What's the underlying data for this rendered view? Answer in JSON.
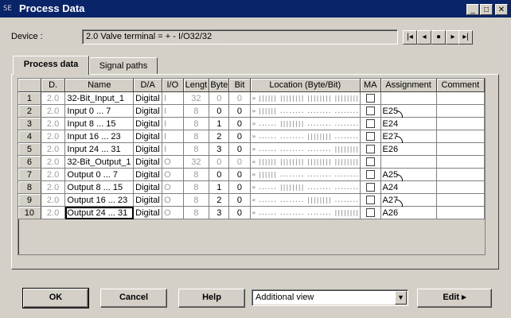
{
  "window": {
    "title": "Process Data",
    "icon_text": "SE"
  },
  "device": {
    "label": "Device :",
    "value": "2.0  Valve terminal  =  +  -   I/O32/32"
  },
  "tabs": [
    {
      "label": "Process data",
      "active": true
    },
    {
      "label": "Signal paths",
      "active": false
    }
  ],
  "table": {
    "columns": [
      "D.",
      "Name",
      "D/A",
      "I/O",
      "Lengt",
      "Byte",
      "Bit",
      "Location (Byte/Bit)",
      "MA",
      "Assignment",
      "Comment"
    ],
    "rows": [
      {
        "n": "1",
        "d": "2.0",
        "name": "32-Bit_Input_1",
        "da": "Digital",
        "io": "I",
        "len": "32",
        "byte": "0",
        "bit": "0",
        "loc": "» |||||| |||||||| |||||||| ||||||||",
        "ma": false,
        "asg": "",
        "comment": "",
        "dim": true
      },
      {
        "n": "2",
        "d": "2.0",
        "name": "Input 0 ... 7",
        "da": "Digital",
        "io": "I",
        "len": "8",
        "byte": "0",
        "bit": "0",
        "loc": "» |||||| ........ ........ ........",
        "ma": false,
        "asg": "E25",
        "comment": "",
        "dim": false
      },
      {
        "n": "3",
        "d": "2.0",
        "name": "Input 8 ... 15",
        "da": "Digital",
        "io": "I",
        "len": "8",
        "byte": "1",
        "bit": "0",
        "loc": "» ...... |||||||| ........ ........",
        "ma": false,
        "asg": "E24",
        "comment": "",
        "dim": false
      },
      {
        "n": "4",
        "d": "2.0",
        "name": "Input 16 ... 23",
        "da": "Digital",
        "io": "I",
        "len": "8",
        "byte": "2",
        "bit": "0",
        "loc": "» ...... ........ |||||||| ........",
        "ma": false,
        "asg": "E27",
        "comment": "",
        "dim": false
      },
      {
        "n": "5",
        "d": "2.0",
        "name": "Input 24 ... 31",
        "da": "Digital",
        "io": "I",
        "len": "8",
        "byte": "3",
        "bit": "0",
        "loc": "» ...... ........ ........ ||||||||",
        "ma": false,
        "asg": "E26",
        "comment": "",
        "dim": false
      },
      {
        "n": "6",
        "d": "2.0",
        "name": "32-Bit_Output_1",
        "da": "Digital",
        "io": "O",
        "len": "32",
        "byte": "0",
        "bit": "0",
        "loc": "« |||||| |||||||| |||||||| ||||||||",
        "ma": false,
        "asg": "",
        "comment": "",
        "dim": true
      },
      {
        "n": "7",
        "d": "2.0",
        "name": "Output 0 ... 7",
        "da": "Digital",
        "io": "O",
        "len": "8",
        "byte": "0",
        "bit": "0",
        "loc": "« |||||| ........ ........ ........",
        "ma": false,
        "asg": "A25",
        "comment": "",
        "dim": false
      },
      {
        "n": "8",
        "d": "2.0",
        "name": "Output 8 ... 15",
        "da": "Digital",
        "io": "O",
        "len": "8",
        "byte": "1",
        "bit": "0",
        "loc": "« ...... |||||||| ........ ........",
        "ma": false,
        "asg": "A24",
        "comment": "",
        "dim": false
      },
      {
        "n": "9",
        "d": "2.0",
        "name": "Output 16 ... 23",
        "da": "Digital",
        "io": "O",
        "len": "8",
        "byte": "2",
        "bit": "0",
        "loc": "« ...... ........ |||||||| ........",
        "ma": false,
        "asg": "A27",
        "comment": "",
        "dim": false
      },
      {
        "n": "10",
        "d": "2.0",
        "name": "Output 24 ... 31",
        "da": "Digital",
        "io": "O",
        "len": "8",
        "byte": "3",
        "bit": "0",
        "loc": "« ...... ........ ........ ||||||||",
        "ma": false,
        "asg": "A26",
        "comment": "",
        "dim": false
      }
    ]
  },
  "buttons": {
    "ok": "OK",
    "cancel": "Cancel",
    "help": "Help",
    "edit": "Edit ▸"
  },
  "additional_view": {
    "value": "Additional view"
  },
  "icons": {
    "minimize": "minimize-icon",
    "maximize": "maximize-icon",
    "close": "close-icon",
    "nav_first": "first-icon",
    "nav_prev": "prev-icon",
    "nav_current": "current-icon",
    "nav_next": "next-icon",
    "nav_last": "last-icon",
    "dropdown": "chevron-down-icon"
  }
}
